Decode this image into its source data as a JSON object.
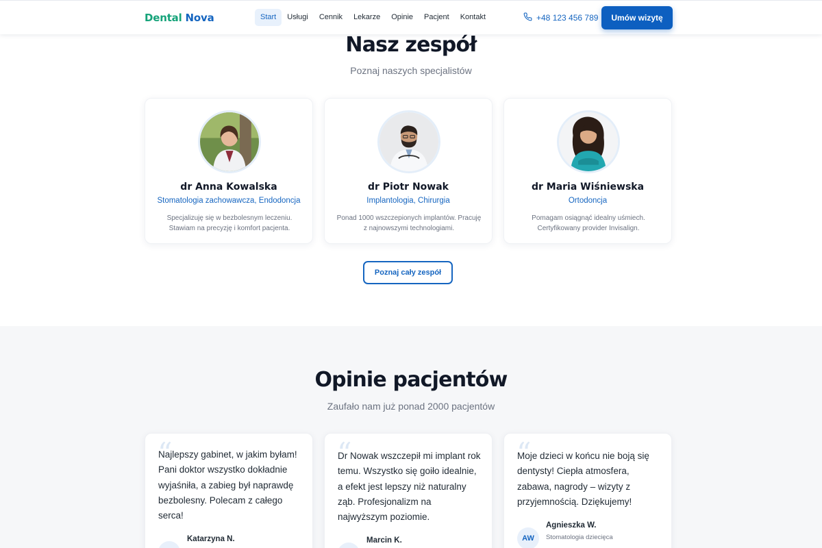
{
  "header": {
    "logo_part1": "Dental",
    "logo_part2": "Nova",
    "nav": [
      "Start",
      "Usługi",
      "Cennik",
      "Lekarze",
      "Opinie",
      "Pacjent",
      "Kontakt"
    ],
    "active_nav": "Start",
    "phone": "+48 123 456 789",
    "phone_icon": "phone-icon",
    "cta_label": "Umów wizytę"
  },
  "team": {
    "title": "Nasz zespół",
    "subtitle": "Poznaj naszych specjalistów",
    "doctors": [
      {
        "name": "dr Anna Kowalska",
        "specialty": "Stomatologia zachowawcza, Endodoncja",
        "description": "Specjalizuję się w bezbolesnym leczeniu. Stawiam na precyzję i komfort pacjenta."
      },
      {
        "name": "dr Piotr Nowak",
        "specialty": "Implantologia, Chirurgia",
        "description": "Ponad 1000 wszczepionych implantów. Pracuję z najnowszymi technologiami."
      },
      {
        "name": "dr Maria Wiśniewska",
        "specialty": "Ortodoncja",
        "description": "Pomagam osiągnąć idealny uśmiech. Certyfikowany provider Invisalign."
      }
    ],
    "button_label": "Poznaj cały zespół"
  },
  "reviews": {
    "title": "Opinie pacjentów",
    "subtitle": "Zaufało nam już ponad 2000 pacjentów",
    "items": [
      {
        "text": "Najlepszy gabinet, w jakim byłam! Pani doktor wszystko dokładnie wyjaśniła, a zabieg był naprawdę bezbolesny. Polecam z całego serca!",
        "initials": "",
        "name": "Katarzyna N.",
        "service": ""
      },
      {
        "text": "Dr Nowak wszczepił mi implant rok temu. Wszystko się goiło idealnie, a efekt jest lepszy niż naturalny ząb. Profesjonalizm na najwyższym poziomie.",
        "initials": "",
        "name": "Marcin K.",
        "service": ""
      },
      {
        "text": "Moje dzieci w końcu nie boją się dentysty! Ciepła atmosfera, zabawa, nagrody – wizyty z przyjemnością. Dziękujemy!",
        "initials": "AW",
        "name": "Agnieszka W.",
        "service": "Stomatologia dziecięca"
      }
    ]
  },
  "colors": {
    "primary": "#1565c0",
    "logo_green": "#16a37a",
    "section_bg": "#f6f7f9"
  }
}
